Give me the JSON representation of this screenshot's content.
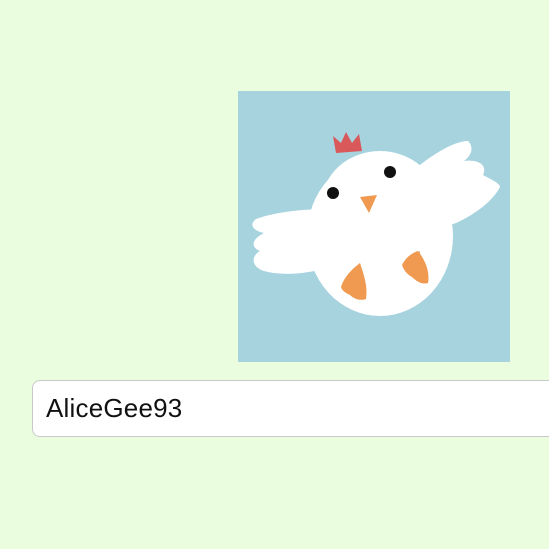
{
  "colors": {
    "page_background": "#ebfddf",
    "avatar_background": "#a7d3df",
    "chicken_body": "#ffffff",
    "comb": "#d9585a",
    "beak_and_feet": "#ef9a50",
    "eyes": "#111111"
  },
  "avatar": {
    "icon": "chicken-avatar-icon"
  },
  "username_field": {
    "value": "AliceGee93"
  }
}
